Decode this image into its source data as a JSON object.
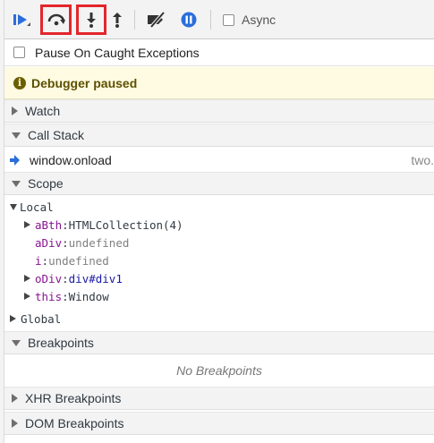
{
  "toolbar": {
    "resume": "resume-icon",
    "step_over": "step-over-icon",
    "step_into": "step-into-icon",
    "step_out": "step-out-icon",
    "deactivate": "deactivate-breakpoints-icon",
    "pause_exceptions": "pause-on-exceptions-icon",
    "async_label": "Async",
    "highlight_color": "#e3262b",
    "accent": "#2a6edb"
  },
  "pause_on_caught": {
    "label": "Pause On Caught Exceptions"
  },
  "banner": {
    "icon": "info-icon",
    "text": "Debugger paused"
  },
  "sections": {
    "watch": "Watch",
    "call_stack": "Call Stack",
    "scope": "Scope",
    "breakpoints": "Breakpoints",
    "xhr": "XHR Breakpoints",
    "dom": "DOM Breakpoints"
  },
  "call_stack": {
    "frames": [
      {
        "name": "window.onload",
        "location": "two."
      }
    ]
  },
  "scope": {
    "local_label": "Local",
    "global_label": "Global",
    "items": [
      {
        "name": "aBth",
        "sep": ": ",
        "value": "HTMLCollection(4)"
      },
      {
        "name": "aDiv",
        "sep": ": ",
        "value": "undefined"
      },
      {
        "name": "i",
        "sep": ": ",
        "value": "undefined"
      },
      {
        "name": "oDiv",
        "sep": ": ",
        "value": "div#div1"
      },
      {
        "name": "this",
        "sep": ": ",
        "value": "Window"
      }
    ]
  },
  "breakpoints": {
    "empty_text": "No Breakpoints"
  }
}
